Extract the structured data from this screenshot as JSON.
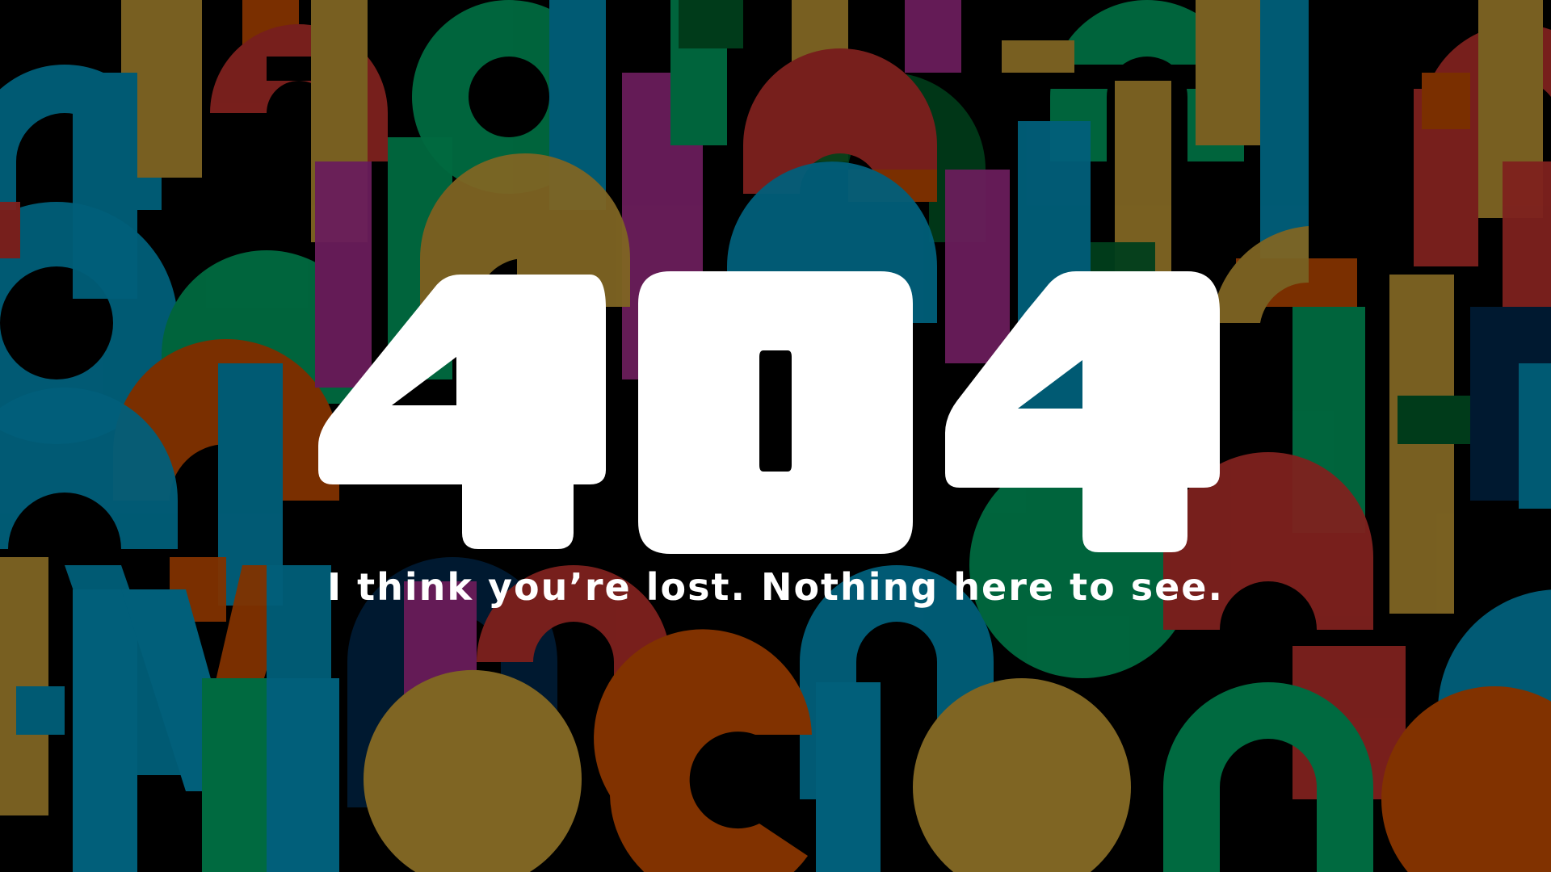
{
  "error": {
    "code": "404",
    "message": "I think you’re lost. Nothing here to see."
  },
  "background": {
    "description_icon": "abstract-letter-pattern",
    "palette": {
      "base": "#000000",
      "teal": "#015f7a",
      "olive": "#7f6523",
      "rust": "#7e211e",
      "green": "#006a40",
      "purple": "#6a1d5b",
      "orange": "#813200",
      "navy": "#001b33",
      "darkgreen": "#003f1c"
    },
    "letters": "Mociona"
  },
  "colors": {
    "text": "#ffffff"
  }
}
